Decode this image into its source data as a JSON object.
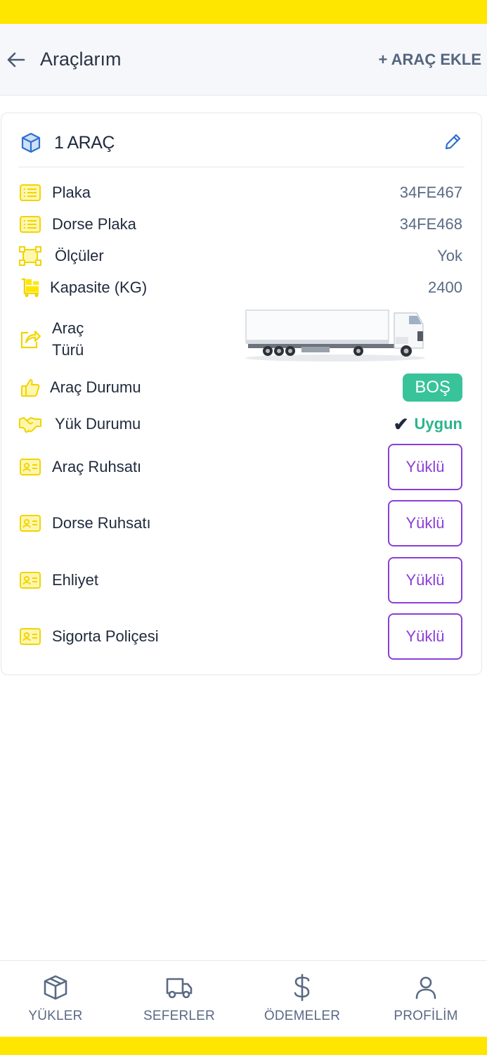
{
  "header": {
    "title": "Araçlarım",
    "add_label": "+ ARAÇ EKLE"
  },
  "card": {
    "title": "1 ARAÇ",
    "fields": [
      {
        "label": "Plaka",
        "value": "34FE467",
        "icon": "list-icon"
      },
      {
        "label": "Dorse Plaka",
        "value": "34FE468",
        "icon": "list-icon"
      },
      {
        "label": "Ölçüler",
        "value": "Yok",
        "icon": "dimensions-icon"
      },
      {
        "label": "Kapasite (KG)",
        "value": "2400",
        "icon": "cart-icon"
      }
    ],
    "vehicle_type": {
      "label_line1": "Araç",
      "label_line2": "Türü",
      "image": "semi-truck-trailer"
    },
    "vehicle_status": {
      "label": "Araç Durumu",
      "value": "BOŞ"
    },
    "load_status": {
      "label": "Yük Durumu",
      "check": "✔",
      "value": "Uygun"
    },
    "documents": [
      {
        "label": "Araç Ruhsatı",
        "button": "Yüklü"
      },
      {
        "label": "Dorse Ruhsatı",
        "button": "Yüklü"
      },
      {
        "label": "Ehliyet",
        "button": "Yüklü"
      },
      {
        "label": "Sigorta Poliçesi",
        "button": "Yüklü"
      }
    ]
  },
  "nav": {
    "items": [
      {
        "label": "YÜKLER",
        "icon": "box-icon"
      },
      {
        "label": "SEFERLER",
        "icon": "truck-icon"
      },
      {
        "label": "ÖDEMELER",
        "icon": "dollar-icon"
      },
      {
        "label": "PROFİLİM",
        "icon": "user-icon"
      }
    ]
  },
  "colors": {
    "accent_yellow": "#ffe600",
    "status_green": "#38c39b",
    "upload_purple": "#8a3fd6",
    "icon_blue": "#2f6fd1"
  }
}
